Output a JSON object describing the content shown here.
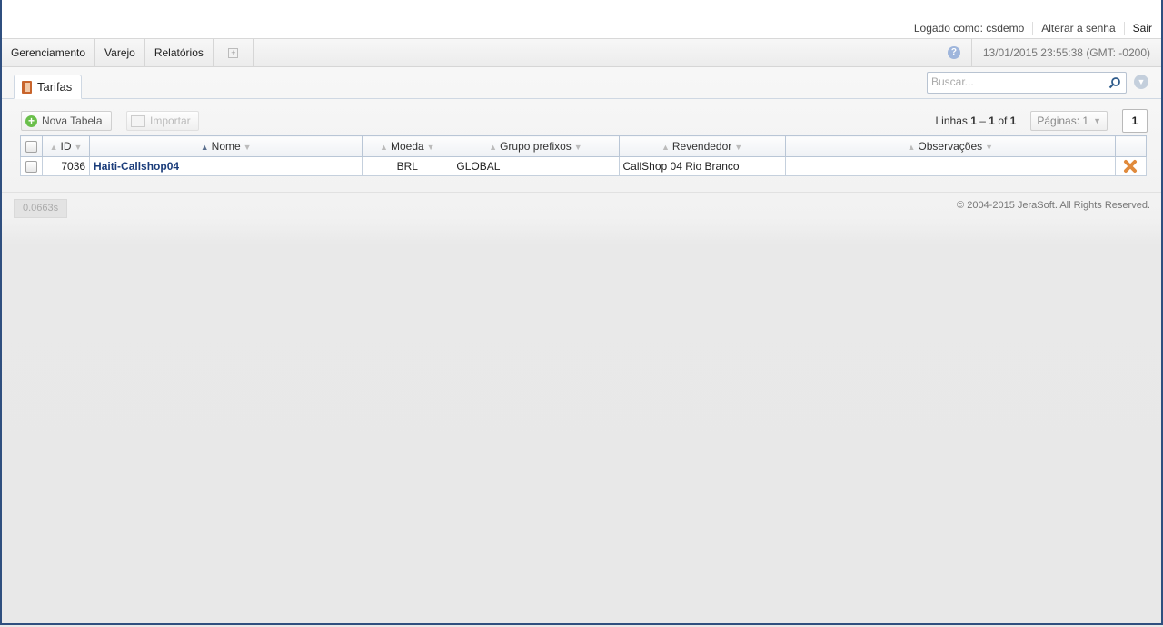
{
  "header": {
    "logged_as": "Logado como: csdemo",
    "change_password": "Alterar a senha",
    "logout": "Sair"
  },
  "menu": {
    "items": [
      "Gerenciamento",
      "Varejo",
      "Relatórios"
    ],
    "help": "?",
    "datetime": "13/01/2015 23:55:38 (GMT: -0200)"
  },
  "tab": {
    "label": "Tarifas"
  },
  "search": {
    "placeholder": "Buscar..."
  },
  "toolbar": {
    "new_label": "Nova Tabela",
    "import_label": "Importar",
    "rows_prefix": "Linhas",
    "rows_from": "1",
    "rows_dash": "–",
    "rows_to": "1",
    "rows_of": "of",
    "rows_total": "1",
    "pages_label": "Páginas: 1",
    "current_page": "1"
  },
  "table": {
    "columns": [
      "ID",
      "Nome",
      "Moeda",
      "Grupo prefixos",
      "Revendedor",
      "Observações"
    ],
    "rows": [
      {
        "id": "7036",
        "name": "Haiti-Callshop04",
        "currency": "BRL",
        "prefix_group": "GLOBAL",
        "reseller": "CallShop 04 Rio Branco",
        "notes": ""
      }
    ]
  },
  "footer": {
    "timing": "0.0663s",
    "copyright": "© 2004-2015 JeraSoft. All Rights Reserved."
  },
  "colors": {
    "accent": "#1a3c7a",
    "border": "#aebed3",
    "frame": "#2f4f7f",
    "delete": "#e08a3c",
    "new_icon": "#6abf4b"
  }
}
